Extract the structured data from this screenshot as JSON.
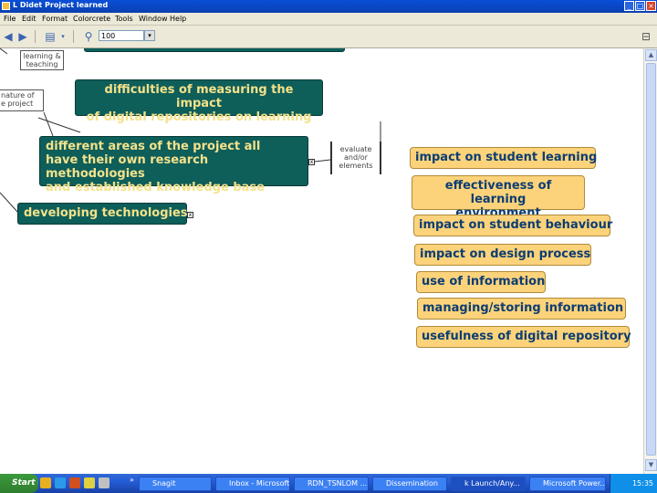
{
  "window": {
    "title": "L Didet Project learned",
    "min_label": "_",
    "max_label": "□",
    "close_label": "×"
  },
  "menu": [
    "File",
    "Edit",
    "Format",
    "Colorcrete",
    "Tools",
    "Window",
    "Help"
  ],
  "toolbar": {
    "zoom_value": "100",
    "zoom_arrow": "▾",
    "right_icon": "⊟"
  },
  "map": {
    "left_fragment_top": "learning &\nteaching",
    "left_fragment_nature": "nature of\ne project",
    "difficulties": "difficulties of measuring the impact\nof digital repositories on learning",
    "different_areas": "different areas of the project all\nhave their own research methodologies\nand established knowledge base",
    "evaluate": "evaluate\nand/or\nelements",
    "developing": "developing technologies",
    "expander_symbol": "x",
    "outcomes": [
      "impact on student learning",
      "effectiveness of learning\nenvironment",
      "impact on student behaviour",
      "impact on design process",
      "use of information",
      "managing/storing information",
      "usefulness of digital repository"
    ]
  },
  "taskbar": {
    "start": "Start",
    "chevron": "»",
    "items": [
      "Snagit",
      "Inbox - Microsoft ...",
      "RDN_TSNLOM ...",
      "Dissemination",
      "k Launch/Any...",
      "Microsoft Power..."
    ],
    "clock": "15:35"
  },
  "colors": {
    "teal_node": "#0e5e5a",
    "teal_text": "#f4e28a",
    "yellow_node": "#fcd37a",
    "yellow_text": "#0d3d73"
  }
}
